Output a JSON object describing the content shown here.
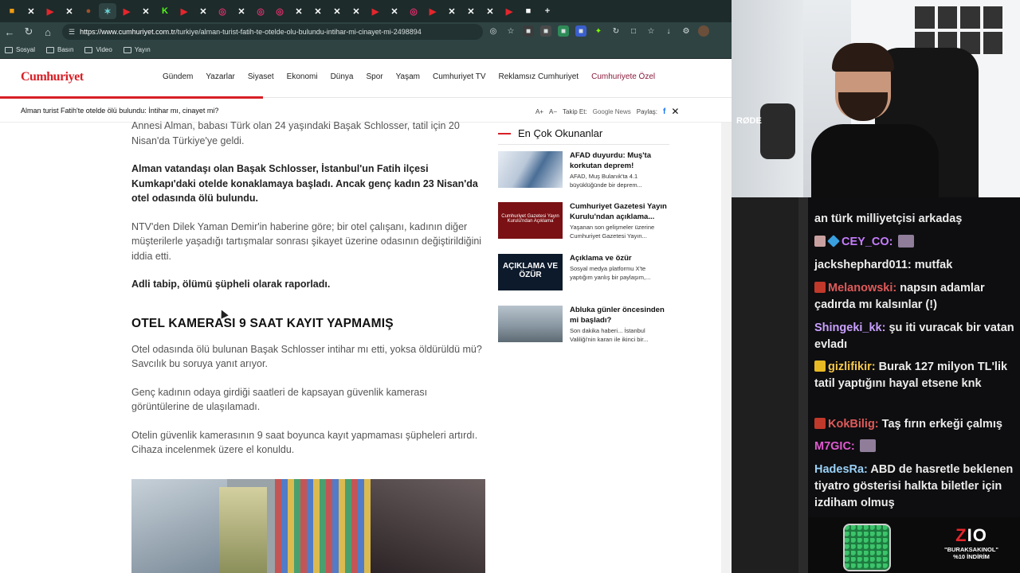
{
  "browser": {
    "tabs": [
      {
        "icon": "orange",
        "color": "#f39c12"
      },
      {
        "icon": "x",
        "color": "#ffffff"
      },
      {
        "icon": "youtube",
        "color": "#e4262c"
      },
      {
        "icon": "x",
        "color": "#ffffff"
      },
      {
        "icon": "avatar",
        "color": "#a0522d"
      },
      {
        "icon": "active",
        "color": "#6dd5d5"
      },
      {
        "icon": "youtube",
        "color": "#e4262c"
      },
      {
        "icon": "x",
        "color": "#ffffff"
      },
      {
        "icon": "kick",
        "color": "#53fc18"
      },
      {
        "icon": "youtube",
        "color": "#e4262c"
      },
      {
        "icon": "x",
        "color": "#ffffff"
      },
      {
        "icon": "instagram",
        "color": "#e1306c"
      },
      {
        "icon": "x",
        "color": "#ffffff"
      },
      {
        "icon": "instagram",
        "color": "#e1306c"
      },
      {
        "icon": "instagram",
        "color": "#e1306c"
      },
      {
        "icon": "x",
        "color": "#ffffff"
      },
      {
        "icon": "x",
        "color": "#ffffff"
      },
      {
        "icon": "x",
        "color": "#ffffff"
      },
      {
        "icon": "x",
        "color": "#ffffff"
      },
      {
        "icon": "youtube",
        "color": "#e4262c"
      },
      {
        "icon": "x",
        "color": "#ffffff"
      },
      {
        "icon": "instagram",
        "color": "#e1306c"
      },
      {
        "icon": "youtube",
        "color": "#e4262c"
      },
      {
        "icon": "x",
        "color": "#ffffff"
      },
      {
        "icon": "x",
        "color": "#ffffff"
      },
      {
        "icon": "x",
        "color": "#ffffff"
      },
      {
        "icon": "youtube",
        "color": "#e4262c"
      },
      {
        "icon": "twitch",
        "color": "#ffffff"
      }
    ],
    "url_host": "https://www.cumhuriyet.com.tr",
    "url_path": "/turkiye/alman-turist-fatih-te-otelde-olu-bulundu-intihar-mi-cinayet-mi-2498894",
    "bookmarks": [
      "Sosyal",
      "Basın",
      "Video",
      "Yayın"
    ],
    "new_tab": "+"
  },
  "site": {
    "logo": "Cumhuriyet",
    "nav": [
      "Gündem",
      "Yazarlar",
      "Siyaset",
      "Ekonomi",
      "Dünya",
      "Spor",
      "Yaşam",
      "Cumhuriyet TV",
      "Reklamsız Cumhuriyet",
      "Cumhuriyete Özel"
    ],
    "sticky_title": "Alman turist Fatih'te otelde ölü bulundu: İntihar mı, cinayet mi?",
    "font_larger": "A+",
    "font_smaller": "A−",
    "follow_label": "Takip Et:",
    "google_news": "Google News",
    "share_label": "Paylaş:"
  },
  "article": {
    "p1": "Annesi Alman, babası Türk olan 24 yaşındaki Başak Schlosser, tatil için 20 Nisan'da Türkiye'ye geldi.",
    "p2": "Alman vatandaşı olan Başak Schlosser, İstanbul'un Fatih ilçesi Kumkapı'daki otelde konaklamaya başladı. Ancak genç kadın 23 Nisan'da otel odasında ölü bulundu.",
    "p3": "NTV'den Dilek Yaman Demir'in haberine göre; bir otel çalışanı, kadının diğer müşterilerle yaşadığı tartışmalar sonrası şikayet üzerine odasının değiştirildiğini iddia etti.",
    "p4": "Adli tabip, ölümü şüpheli olarak raporladı.",
    "h2": "OTEL KAMERASI 9 SAAT KAYIT YAPMAMIŞ",
    "p5": "Otel odasında ölü bulunan Başak Schlosser intihar mı etti, yoksa öldürüldü mü? Savcılık bu soruya yanıt arıyor.",
    "p6": "Genç kadının odaya girdiği saatleri de kapsayan güvenlik kamerası görüntülerine de ulaşılamadı.",
    "p7": "Otelin güvenlik kamerasının 9 saat boyunca kayıt yapmaması şüpheleri artırdı. Cihaza incelenmek üzere el konuldu."
  },
  "sidebar": {
    "title": "En Çok Okunanlar",
    "items": [
      {
        "head": "AFAD duyurdu: Muş'ta korkutan deprem!",
        "sub": "AFAD, Muş Bulanık'ta 4.1 büyüklüğünde bir deprem..."
      },
      {
        "head": "Cumhuriyet Gazetesi Yayın Kurulu'ndan açıklama...",
        "sub": "Yaşanan son gelişmeler üzerine Cumhuriyet Gazetesi Yayın...",
        "thumb_text": "Cumhuriyet Gazetesi Yayın Kurulu'ndan Açıklama"
      },
      {
        "head": "Açıklama ve özür",
        "sub": "Sosyal medya platformu X'te yaptığım yanlış bir paylaşım,...",
        "thumb_text": "AÇIKLAMA VE ÖZÜR"
      },
      {
        "head": "Abluka günler öncesinden mi başladı?",
        "sub": "Son dakika haberi... İstanbul Valiliği'nin kararı ile ikinci bir..."
      }
    ]
  },
  "webcam": {
    "mic_brand": "RØDE"
  },
  "chat": {
    "messages": [
      {
        "user": "",
        "text": "an türk milliyetçisi arkadaş",
        "color": "#ececec"
      },
      {
        "user": "CEY_CO:",
        "text": "",
        "color": "#c77dff"
      },
      {
        "user": "jackshephard011:",
        "text": "mutfak",
        "color": "#ececec"
      },
      {
        "user": "Melanowski:",
        "text": "napsın adamlar çadırda mı kalsınlar (!)",
        "color": "#e05a5a"
      },
      {
        "user": "Shingeki_kk:",
        "text": "şu iti vuracak bir vatan evladı",
        "color": "#c9a0ff"
      },
      {
        "user": "gizlifikir:",
        "text": "Burak 127 milyon TL'lik tatil yaptığını hayal etsene knk",
        "color": "#f5c84c"
      },
      {
        "user": "KokBilig:",
        "text": "Taş fırın erkeği çalmış",
        "color": "#e05a5a"
      },
      {
        "user": "M7GIC:",
        "text": "",
        "color": "#e05ad0"
      },
      {
        "user": "HadesRa:",
        "text": "ABD de hasretle beklenen tiyatro gösterisi halkta biletler için izdiham olmuş",
        "color": "#9ad1f7"
      }
    ]
  },
  "promo": {
    "brand_z": "Z",
    "brand_rest": "IO",
    "line1": "\"BURAKSAKINOL\"",
    "line2": "%10 İNDİRİM"
  }
}
